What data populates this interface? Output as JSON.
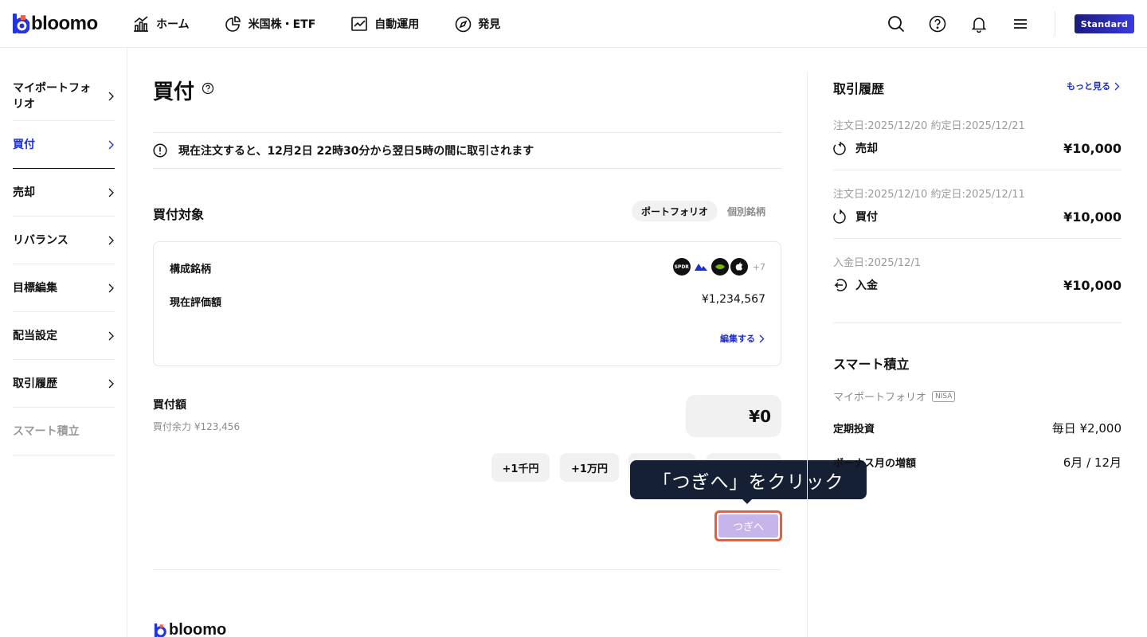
{
  "header": {
    "brand": "bloomo",
    "nav": [
      {
        "label": "ホーム",
        "icon": "chart-bar-icon"
      },
      {
        "label": "米国株・ETF",
        "icon": "pie-chart-icon"
      },
      {
        "label": "自動運用",
        "icon": "line-chart-icon"
      },
      {
        "label": "発見",
        "icon": "compass-icon"
      }
    ],
    "icons": [
      "search-icon",
      "help-icon",
      "bell-icon",
      "menu-icon"
    ],
    "plan_badge": "Standard"
  },
  "sidebar": {
    "items": [
      {
        "label": "マイポートフォリオ",
        "state": "normal"
      },
      {
        "label": "買付",
        "state": "active"
      },
      {
        "label": "売却",
        "state": "normal"
      },
      {
        "label": "リバランス",
        "state": "normal"
      },
      {
        "label": "目標編集",
        "state": "normal"
      },
      {
        "label": "配当設定",
        "state": "normal"
      },
      {
        "label": "取引履歴",
        "state": "normal"
      },
      {
        "label": "スマート積立",
        "state": "disabled"
      }
    ]
  },
  "main": {
    "title": "買付",
    "notice": "現在注文すると、12月2日 22時30分から翌日5時の間に取引されます",
    "target_title": "買付対象",
    "segments": [
      "ポートフォリオ",
      "個別銘柄"
    ],
    "card": {
      "holdings_label": "構成銘柄",
      "logos": [
        "SPDR",
        "",
        "",
        ""
      ],
      "more_count": "+7",
      "value_label": "現在評価額",
      "value": "¥1,234,567",
      "edit_label": "編集する"
    },
    "amount_title": "買付額",
    "amount_sub": "買付余力  ¥123,456",
    "amount_value": "¥0",
    "chips": [
      "+1千円",
      "+1万円",
      "",
      ""
    ],
    "next_label": "つぎへ",
    "tooltip": "「つぎへ」をクリック",
    "footer_brand": "bloomo"
  },
  "history": {
    "title": "取引履歴",
    "more": "もっと見る",
    "items": [
      {
        "date": "注文日:2025/12/20   約定日:2025/12/21",
        "type": "売却",
        "amount": "¥10,000"
      },
      {
        "date": "注文日:2025/12/10   約定日:2025/12/11",
        "type": "買付",
        "amount": "¥10,000"
      },
      {
        "date": "入金日:2025/12/1",
        "type": "入金",
        "amount": "¥10,000"
      }
    ]
  },
  "smart": {
    "title": "スマート積立",
    "portfolio": "マイポートフォリオ",
    "tag": "NISA",
    "rows": [
      {
        "label": "定期投資",
        "value": "毎日 ¥2,000"
      },
      {
        "label": "ボーナス月の増額",
        "value": "6月 / 12月"
      }
    ]
  },
  "colors": {
    "accent": "#1b2fd6",
    "tooltip_bg": "#152034",
    "highlight": "#ee5a3a",
    "next_btn": "#c7b4ea"
  }
}
